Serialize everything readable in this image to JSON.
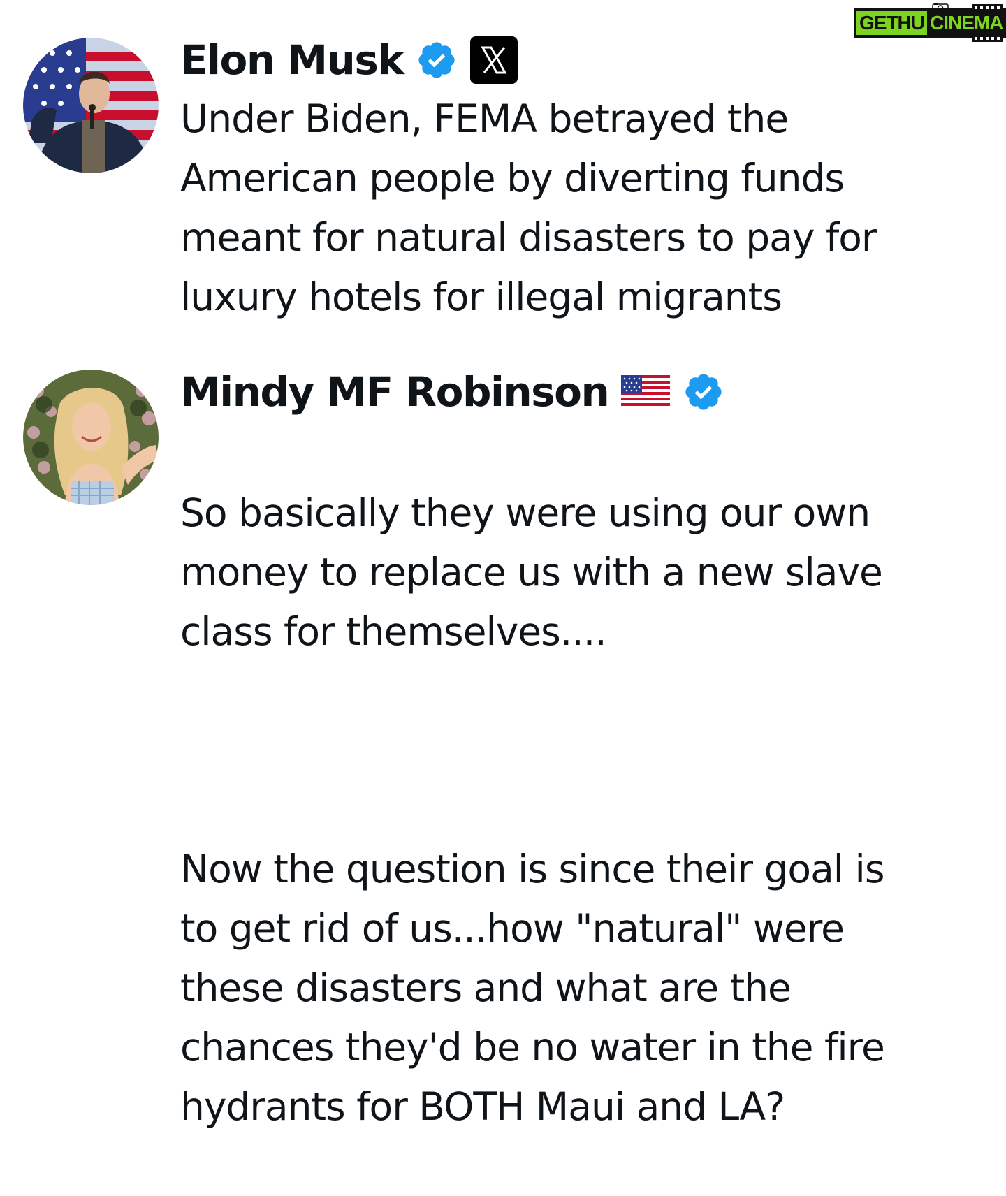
{
  "watermark": {
    "part1": "GETHU",
    "part2": "CINEMA"
  },
  "posts": [
    {
      "author": {
        "name": "Elon Musk",
        "verified": true,
        "affiliate_badge": "x-logo-icon"
      },
      "text": "Under Biden, FEMA betrayed the\nAmerican people by diverting funds\nmeant for natural disasters to pay for\nluxury hotels for illegal migrants"
    },
    {
      "author": {
        "name": "Mindy MF Robinson",
        "flag": "us-flag-icon",
        "verified": true
      },
      "paragraphs": [
        "So basically they were using our own\nmoney to replace us with a new slave\nclass for themselves....",
        "Now the question is since their goal is\nto get rid of us...how \"natural\" were\nthese disasters and what are the\nchances they'd be no water in the fire\nhydrants for BOTH Maui and LA?"
      ]
    }
  ],
  "colors": {
    "text": "#0f1419",
    "verified_blue": "#1d9bf0",
    "watermark_green": "#7ed321"
  }
}
